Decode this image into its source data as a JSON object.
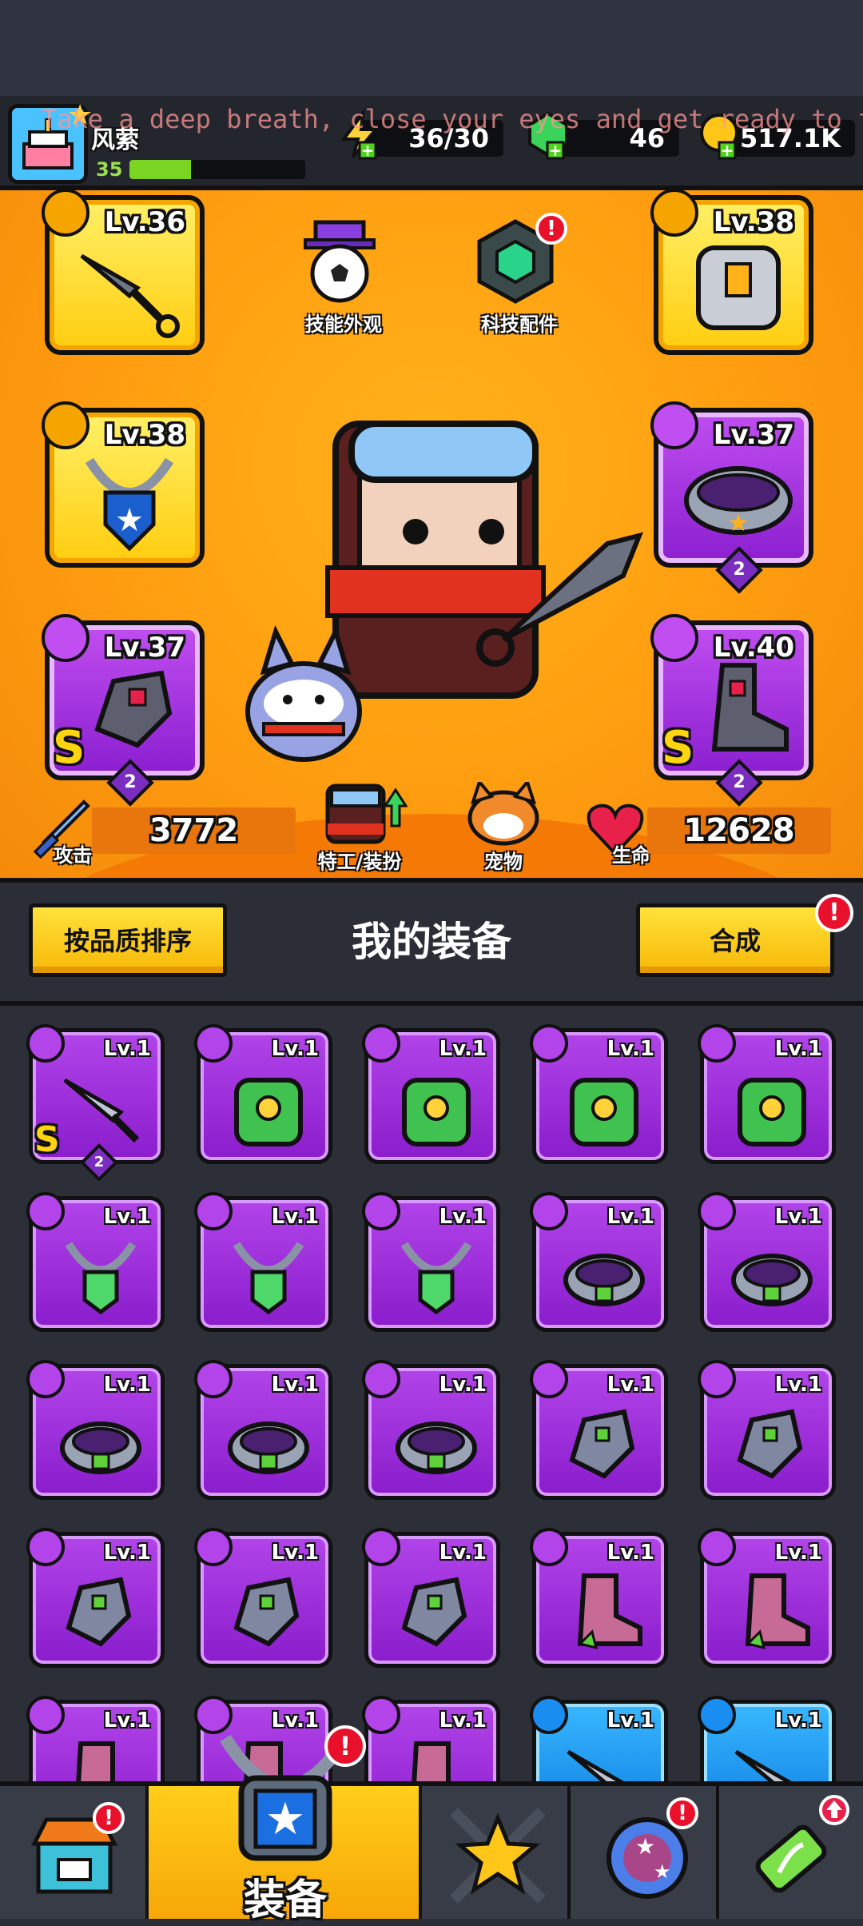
{
  "player": {
    "name": "风萦",
    "level": "35",
    "xp_fraction": 0.35
  },
  "resources": {
    "energy": "36/30",
    "gems": "46",
    "gold": "517.1K"
  },
  "overlay_text": "Take a deep breath, close your eyes and get ready to fly",
  "hero": {
    "skill_appearance_label": "技能外观",
    "tech_parts_label": "科技配件",
    "agent_label": "特工/装扮",
    "pet_label": "宠物",
    "attack_label": "攻击",
    "attack_value": "3772",
    "hp_label": "生命",
    "hp_value": "12628",
    "slots": [
      {
        "slot": "weapon",
        "level": "Lv.36",
        "style": "gold"
      },
      {
        "slot": "armor",
        "level": "Lv.38",
        "style": "gold"
      },
      {
        "slot": "necklace",
        "level": "Lv.38",
        "style": "gold"
      },
      {
        "slot": "belt",
        "level": "Lv.37",
        "style": "purple",
        "stars": "2"
      },
      {
        "slot": "gloves",
        "level": "Lv.37",
        "style": "purple",
        "grade": "S",
        "stars": "2"
      },
      {
        "slot": "boots",
        "level": "Lv.40",
        "style": "purple",
        "grade": "S",
        "stars": "2"
      }
    ]
  },
  "equipment": {
    "title": "我的装备",
    "sort_button": "按品质排序",
    "merge_button": "合成",
    "items": [
      {
        "type": "weapon",
        "level": "Lv.1",
        "color": "purple",
        "grade": "S",
        "stars": "2"
      },
      {
        "type": "armor",
        "level": "Lv.1",
        "color": "purple"
      },
      {
        "type": "armor",
        "level": "Lv.1",
        "color": "purple"
      },
      {
        "type": "armor",
        "level": "Lv.1",
        "color": "purple"
      },
      {
        "type": "armor",
        "level": "Lv.1",
        "color": "purple"
      },
      {
        "type": "necklace",
        "level": "Lv.1",
        "color": "purple"
      },
      {
        "type": "necklace",
        "level": "Lv.1",
        "color": "purple"
      },
      {
        "type": "necklace",
        "level": "Lv.1",
        "color": "purple"
      },
      {
        "type": "belt",
        "level": "Lv.1",
        "color": "purple"
      },
      {
        "type": "belt",
        "level": "Lv.1",
        "color": "purple"
      },
      {
        "type": "belt",
        "level": "Lv.1",
        "color": "purple"
      },
      {
        "type": "belt",
        "level": "Lv.1",
        "color": "purple"
      },
      {
        "type": "belt",
        "level": "Lv.1",
        "color": "purple"
      },
      {
        "type": "gloves",
        "level": "Lv.1",
        "color": "purple"
      },
      {
        "type": "gloves",
        "level": "Lv.1",
        "color": "purple"
      },
      {
        "type": "gloves",
        "level": "Lv.1",
        "color": "purple"
      },
      {
        "type": "gloves",
        "level": "Lv.1",
        "color": "purple"
      },
      {
        "type": "gloves",
        "level": "Lv.1",
        "color": "purple"
      },
      {
        "type": "boots",
        "level": "Lv.1",
        "color": "purple"
      },
      {
        "type": "boots",
        "level": "Lv.1",
        "color": "purple"
      },
      {
        "type": "boots",
        "level": "Lv.1",
        "color": "purple"
      },
      {
        "type": "boots",
        "level": "Lv.1",
        "color": "purple"
      },
      {
        "type": "boots",
        "level": "Lv.1",
        "color": "purple"
      },
      {
        "type": "weapon",
        "level": "Lv.1",
        "color": "blue"
      },
      {
        "type": "weapon",
        "level": "Lv.1",
        "color": "blue"
      }
    ]
  },
  "nav": {
    "equip_label": "装备",
    "notif_mark": "!"
  }
}
